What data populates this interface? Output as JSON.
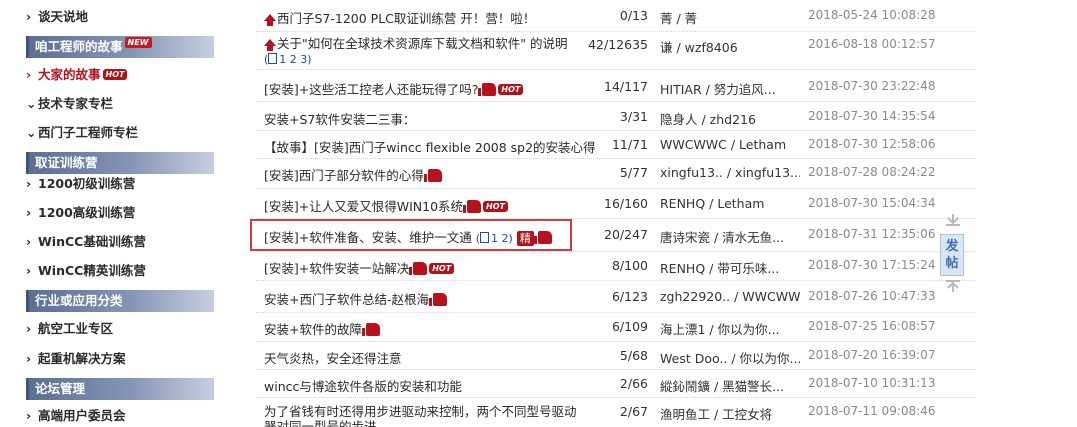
{
  "sidebar": {
    "top_item": "谈天说地",
    "section1": {
      "title": "咱工程师的故事",
      "badge": "NEW"
    },
    "story_items": [
      {
        "label": "大家的故事",
        "badge": "HOT"
      },
      {
        "label": "技术专家专栏"
      },
      {
        "label": "西门子工程师专栏"
      }
    ],
    "section2": {
      "title": "取证训练营"
    },
    "camp_items": [
      "1200初级训练营",
      "1200高级训练营",
      "WinCC基础训练营",
      "WinCC精英训练营"
    ],
    "section3": {
      "title": "行业或应用分类"
    },
    "industry_items": [
      "航空工业专区",
      "起重机解决方案"
    ],
    "section4": {
      "title": "论坛管理"
    },
    "manage_items": [
      "高端用户委员会"
    ]
  },
  "threads": [
    {
      "title": "西门子S7-1200 PLC取证训练营 开！营！啦！",
      "count": "0/13",
      "people": "菁 / 菁",
      "date": "2018-05-24 10:08:28",
      "pinned": true
    },
    {
      "title": "关于\"如何在全球技术资源库下载文档和软件\" 的说明",
      "pages": "1 2 3",
      "count": "42/12635",
      "people": "谦 / wzf8406",
      "date": "2016-08-18 00:12:57",
      "pinned": true
    },
    {
      "title": "[安装]+这些活工控老人还能玩得了吗?",
      "count": "14/117",
      "people": "HITIAR / 努力追风...",
      "date": "2018-07-30 23:22:48",
      "thumb": true,
      "hot": "HOT"
    },
    {
      "title": "安装+S7软件安装二三事：",
      "count": "3/31",
      "people": "隐身人 / zhd216",
      "date": "2018-07-30 14:35:54"
    },
    {
      "title": "【故事】[安装]西门子wincc flexible 2008 sp2的安装心得",
      "count": "11/71",
      "people": "WWCWWC / Letham",
      "date": "2018-07-30 12:58:06"
    },
    {
      "title": "[安装]西门子部分软件的心得",
      "count": "5/77",
      "people": "xingfu13.. / xingfu13...",
      "date": "2018-07-28 08:24:22",
      "thumb": true
    },
    {
      "title": "[安装]+让人又爱又恨得WIN10系统",
      "count": "16/160",
      "people": "RENHQ / Letham",
      "date": "2018-07-30 15:04:34",
      "thumb": true,
      "hot": "HOT"
    },
    {
      "title": "[安装]+软件准备、安装、维护一文通",
      "pages": "1 2",
      "jing": "精",
      "count": "20/247",
      "people": "唐诗宋瓷 / 清水无鱼...",
      "date": "2018-07-31 12:35:06",
      "thumb": true
    },
    {
      "title": "[安装]+软件安装一站解决",
      "count": "8/100",
      "people": "RENHQ / 带可乐味...",
      "date": "2018-07-30 17:15:24",
      "thumb": true,
      "hot": "HOT"
    },
    {
      "title": "安装+西门子软件总结-赵根海",
      "count": "6/123",
      "people": "zgh22920.. / WWCWWC",
      "date": "2018-07-26 10:47:33",
      "thumb": true
    },
    {
      "title": "安装+软件的故障",
      "count": "6/109",
      "people": "海上漂1 / 你以为你...",
      "date": "2018-07-25 16:08:57",
      "thumb": true
    },
    {
      "title": "天气炎热，安全还得注意",
      "count": "5/68",
      "people": "West Doo.. / 你以为你...",
      "date": "2018-07-20 16:39:07"
    },
    {
      "title": "wincc与博途软件各版的安装和功能",
      "count": "2/66",
      "people": "縱鈊鬧鑛 / 黑猫警长...",
      "date": "2018-07-10 10:31:13"
    },
    {
      "title": "为了省钱有时还得用步进驱动来控制，两个不同型号驱动器对同一型号的步进",
      "count": "2/67",
      "people": "渔明鱼工 / 工控女将",
      "date": "2018-07-11 09:08:46"
    }
  ],
  "post_button": {
    "label": "发帖"
  },
  "colors": {
    "accent": "#b5121b",
    "sidebar_header": "#6a7ca0",
    "link_blue": "#1a4f9c",
    "highlight": "#d23b3b"
  }
}
